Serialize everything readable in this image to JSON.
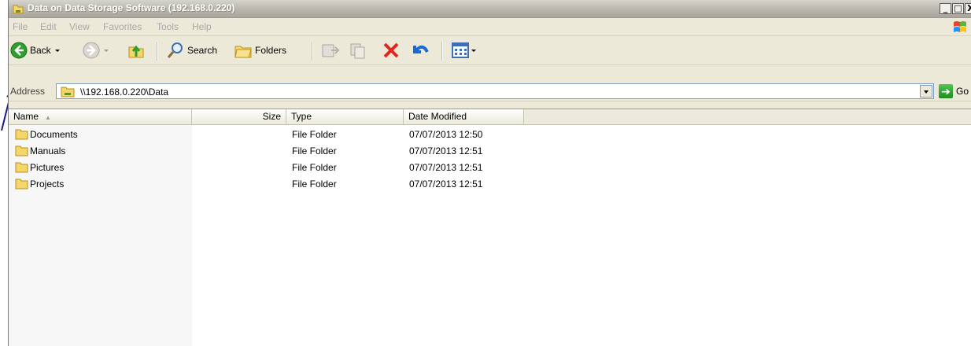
{
  "window": {
    "title": "Data on Data Storage Software (192.168.0.220)",
    "caption_min": "_",
    "caption_max": "□",
    "caption_close": "X"
  },
  "menu": {
    "items": [
      "File",
      "Edit",
      "View",
      "Favorites",
      "Tools",
      "Help"
    ]
  },
  "toolbar": {
    "back_label": "Back",
    "search_label": "Search",
    "folders_label": "Folders"
  },
  "address": {
    "label": "Address",
    "value": "\\\\192.168.0.220\\Data",
    "go_label": "Go"
  },
  "columns": {
    "name": "Name",
    "size": "Size",
    "type": "Type",
    "date": "Date Modified"
  },
  "files": [
    {
      "name": "Documents",
      "size": "",
      "type": "File Folder",
      "date": "07/07/2013 12:50"
    },
    {
      "name": "Manuals",
      "size": "",
      "type": "File Folder",
      "date": "07/07/2013 12:51"
    },
    {
      "name": "Pictures",
      "size": "",
      "type": "File Folder",
      "date": "07/07/2013 12:51"
    },
    {
      "name": "Projects",
      "size": "",
      "type": "File Folder",
      "date": "07/07/2013 12:51"
    }
  ],
  "colors": {
    "titlebar_inactive": "#b9b6ae",
    "annotation_arrow": "#1a1a8c",
    "folder_yellow": "#f5d66b"
  }
}
